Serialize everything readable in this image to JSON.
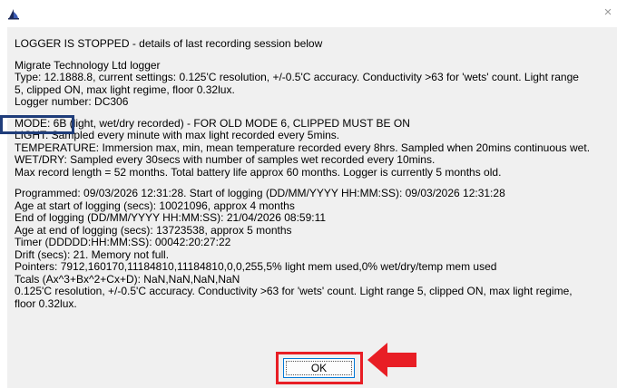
{
  "dialog": {
    "close_glyph": "×",
    "ok_label": "OK",
    "lines": [
      "LOGGER IS STOPPED - details of last recording session below",
      "",
      "Migrate Technology Ltd logger",
      "Type: 12.1888.8, current settings: 0.125'C resolution, +/-0.5'C accuracy. Conductivity >63 for 'wets' count. Light range",
      "5, clipped ON, max light regime, floor 0.32lux.",
      "Logger number: DC306",
      "",
      "MODE: 6B (light, wet/dry recorded) - FOR OLD MODE 6, CLIPPED MUST BE ON",
      "LIGHT: Sampled every minute with max light recorded every 5mins.",
      "TEMPERATURE: Immersion max, min, mean temperature recorded every 8hrs. Sampled when 20mins continuous wet.",
      "WET/DRY: Sampled every 30secs with number of samples wet recorded every 10mins.",
      "Max record length = 52 months. Total battery life approx 60 months. Logger is currently 5 months old.",
      "",
      "Programmed: 09/03/2026 12:31:28. Start of logging (DD/MM/YYYY HH:MM:SS): 09/03/2026 12:31:28",
      "Age at start of logging (secs): 10021096, approx 4 months",
      "End of logging (DD/MM/YYYY HH:MM:SS): 21/04/2026 08:59:11",
      "Age at end of logging (secs): 13723538, approx 5 months",
      "Timer (DDDDD:HH:MM:SS): 00042:20:27:22",
      "Drift (secs): 21. Memory not full.",
      "Pointers: 7912,160170,11184810,11184810,0,0,255,5% light mem used,0% wet/dry/temp mem used",
      "Tcals (Ax^3+Bx^2+Cx+D): NaN,NaN,NaN,NaN",
      "0.125'C resolution, +/-0.5'C accuracy. Conductivity >63 for 'wets' count. Light range 5, clipped ON, max light regime,",
      "floor 0.32lux."
    ]
  },
  "colors": {
    "client_bg": "#f0f0f0",
    "annotation_box": "#1f3d7a",
    "annotation_red": "#e81e25",
    "button_border": "#0078d7"
  },
  "icons": [
    "app-logo-icon",
    "close-icon",
    "annotation-arrow-icon"
  ]
}
